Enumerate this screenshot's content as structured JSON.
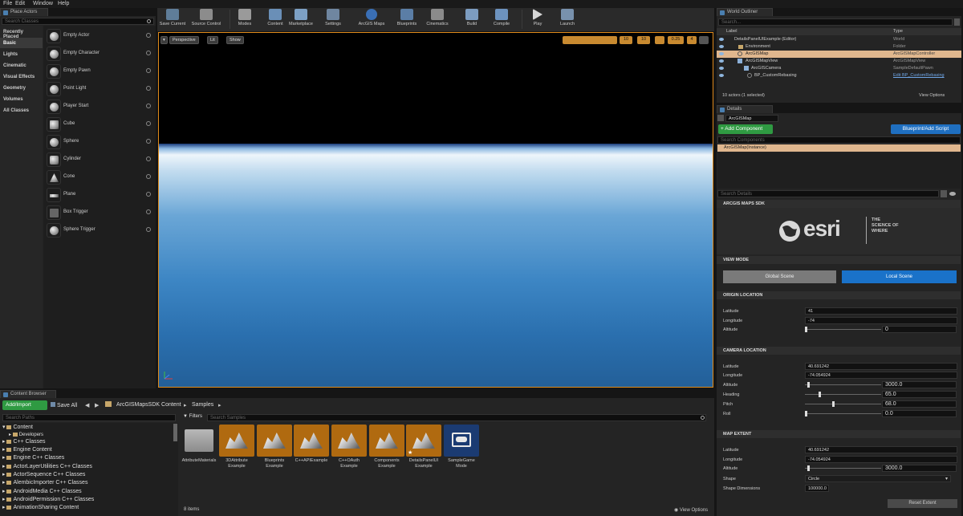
{
  "menu": {
    "file": "File",
    "edit": "Edit",
    "window": "Window",
    "help": "Help"
  },
  "place_actors": {
    "tab": "Place Actors",
    "search_placeholder": "Search Classes",
    "categories": [
      "Recently Placed",
      "Basic",
      "Lights",
      "Cinematic",
      "Visual Effects",
      "Geometry",
      "Volumes",
      "All Classes"
    ],
    "actors": [
      "Empty Actor",
      "Empty Character",
      "Empty Pawn",
      "Point Light",
      "Player Start",
      "Cube",
      "Sphere",
      "Cylinder",
      "Cone",
      "Plane",
      "Box Trigger",
      "Sphere Trigger"
    ]
  },
  "toolbar": {
    "items": [
      "Save Current",
      "Source Control",
      "Modes",
      "Content",
      "Marketplace",
      "Settings",
      "ArcGIS Maps",
      "Blueprints",
      "Cinematics",
      "Build",
      "Compile",
      "Play",
      "Launch"
    ]
  },
  "viewport": {
    "perspective": "Perspective",
    "lit": "Lit",
    "show": "Show",
    "snap1": "10",
    "snap2": "10",
    "snap3": "0.25",
    "cam": "4"
  },
  "outliner": {
    "tab": "World Outliner",
    "search_placeholder": "Search...",
    "col_label": "Label",
    "col_type": "Type",
    "rows": [
      {
        "label": "DetailsPanelUIExample (Editor)",
        "type": "World"
      },
      {
        "label": "Environment",
        "type": "Folder"
      },
      {
        "label": "ArcGISMap",
        "type": "ArcGISMapController"
      },
      {
        "label": "ArcGISMapView",
        "type": "ArcGISMapView"
      },
      {
        "label": "ArcGISCamera",
        "type": "SampleDefaultPawn"
      },
      {
        "label": "BP_CustomRebasing",
        "type": "Edit BP_CustomRebasing"
      }
    ],
    "footer": "10 actors (1 selected)",
    "view_options": "View Options"
  },
  "details": {
    "tab": "Details",
    "name_value": "ArcGISMap",
    "add_component": "+ Add Component",
    "blueprint": "Blueprint/Add Script",
    "search_components": "Search Components",
    "instance": "ArcGISMap(Instance)",
    "search_details": "Search Details",
    "sdk_header": "ARCGIS MAPS SDK",
    "esri_logo": "esri",
    "esri_tag": "THE SCIENCE OF WHERE",
    "view_mode_header": "VIEW MODE",
    "global_scene": "Global Scene",
    "local_scene": "Local Scene",
    "origin_header": "ORIGIN LOCATION",
    "origin": {
      "lat_label": "Latitude",
      "lat": "41",
      "lon_label": "Longitude",
      "lon": "-74",
      "alt_label": "Altitude",
      "alt": "0"
    },
    "camera_header": "CAMERA LOCATION",
    "camera": {
      "lat_label": "Latitude",
      "lat": "40.691242",
      "lon_label": "Longitude",
      "lon": "-74.054924",
      "alt_label": "Altitude",
      "alt": "3000.0",
      "heading_label": "Heading",
      "heading": "65.0",
      "pitch_label": "Pitch",
      "pitch": "68.0",
      "roll_label": "Roll",
      "roll": "0.0"
    },
    "extent_header": "MAP EXTENT",
    "extent": {
      "lat_label": "Latitude",
      "lat": "40.691242",
      "lon_label": "Longitude",
      "lon": "-74.054924",
      "alt_label": "Altitude",
      "alt": "3000.0",
      "shape_label": "Shape",
      "shape": "Circle",
      "dim_label": "Shape Dimensions",
      "dim": "100000.0"
    },
    "reset_extent": "Reset Extent"
  },
  "content_browser": {
    "tab": "Content Browser",
    "add_import": "Add/Import",
    "save_all": "Save All",
    "crumb1": "ArcGISMapsSDK Content",
    "crumb2": "Samples",
    "search_paths": "Search Paths",
    "filters": "Filters",
    "search_samples": "Search Samples",
    "tree": [
      "Content",
      "Developers",
      "C++ Classes",
      "Engine Content",
      "Engine C++ Classes",
      "ActorLayerUtilities C++ Classes",
      "ActorSequence C++ Classes",
      "AlembicImporter C++ Classes",
      "AndroidMedia C++ Classes",
      "AndroidPermission C++ Classes",
      "AnimationSharing Content"
    ],
    "assets": [
      {
        "line1": "AttributeMaterials",
        "line2": ""
      },
      {
        "line1": "3DAttribute",
        "line2": "Example"
      },
      {
        "line1": "Blueprints",
        "line2": "Example"
      },
      {
        "line1": "C++APIExample",
        "line2": ""
      },
      {
        "line1": "C++OAuth",
        "line2": "Example"
      },
      {
        "line1": "Components",
        "line2": "Example"
      },
      {
        "line1": "DetailsPanelUI",
        "line2": "Example"
      },
      {
        "line1": "SampleGame",
        "line2": "Mode"
      }
    ],
    "item_count": "8 items",
    "view_options": "View Options"
  }
}
